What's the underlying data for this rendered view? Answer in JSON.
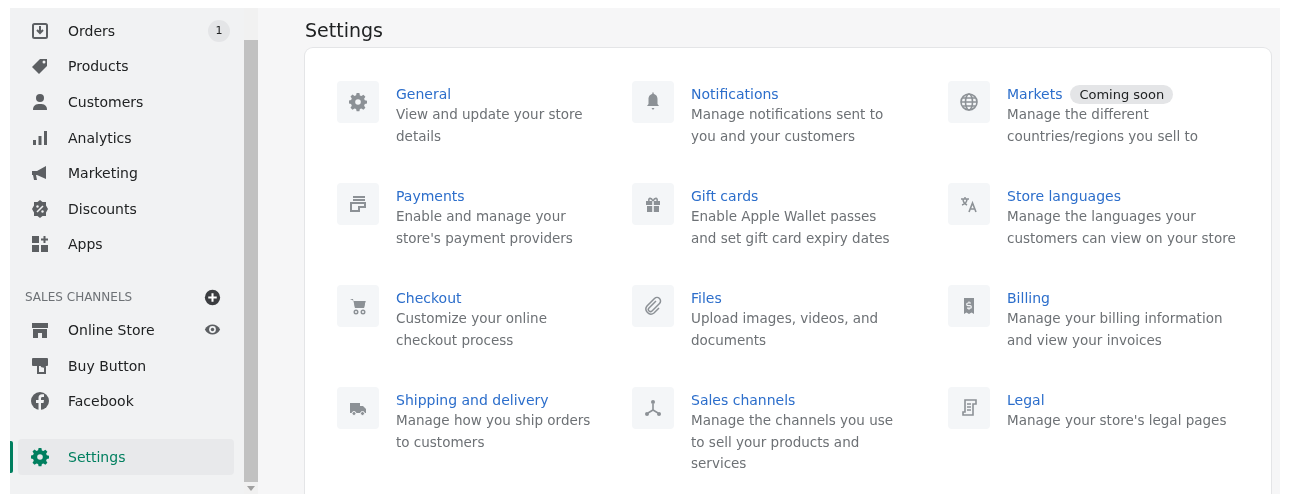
{
  "sidebar": {
    "items": [
      {
        "label": "Orders",
        "badge": "1",
        "selected": false
      },
      {
        "label": "Products",
        "selected": false
      },
      {
        "label": "Customers",
        "selected": false
      },
      {
        "label": "Analytics",
        "selected": false
      },
      {
        "label": "Marketing",
        "selected": false
      },
      {
        "label": "Discounts",
        "selected": false
      },
      {
        "label": "Apps",
        "selected": false
      }
    ],
    "sales_channels": {
      "heading": "SALES CHANNELS",
      "items": [
        {
          "label": "Online Store",
          "selected": false
        },
        {
          "label": "Buy Button",
          "selected": false
        },
        {
          "label": "Facebook",
          "selected": false
        }
      ]
    },
    "footer_items": [
      {
        "label": "Settings",
        "selected": true
      }
    ]
  },
  "page": {
    "title": "Settings",
    "sections": [
      {
        "title": "General",
        "description": "View and update your store details"
      },
      {
        "title": "Notifications",
        "description": "Manage notifications sent to you and your customers"
      },
      {
        "title": "Markets",
        "badge": "Coming soon",
        "description": "Manage the different countries/regions you sell to"
      },
      {
        "title": "Payments",
        "description": "Enable and manage your store's payment providers"
      },
      {
        "title": "Gift cards",
        "description": "Enable Apple Wallet passes and set gift card expiry dates"
      },
      {
        "title": "Store languages",
        "description": "Manage the languages your customers can view on your store"
      },
      {
        "title": "Checkout",
        "description": "Customize your online checkout process"
      },
      {
        "title": "Files",
        "description": "Upload images, videos, and documents"
      },
      {
        "title": "Billing",
        "description": "Manage your billing information and view your invoices"
      },
      {
        "title": "Shipping and delivery",
        "description": "Manage how you ship orders to customers"
      },
      {
        "title": "Sales channels",
        "description": "Manage the channels you use to sell your products and services"
      },
      {
        "title": "Legal",
        "description": "Manage your store's legal pages"
      }
    ]
  }
}
